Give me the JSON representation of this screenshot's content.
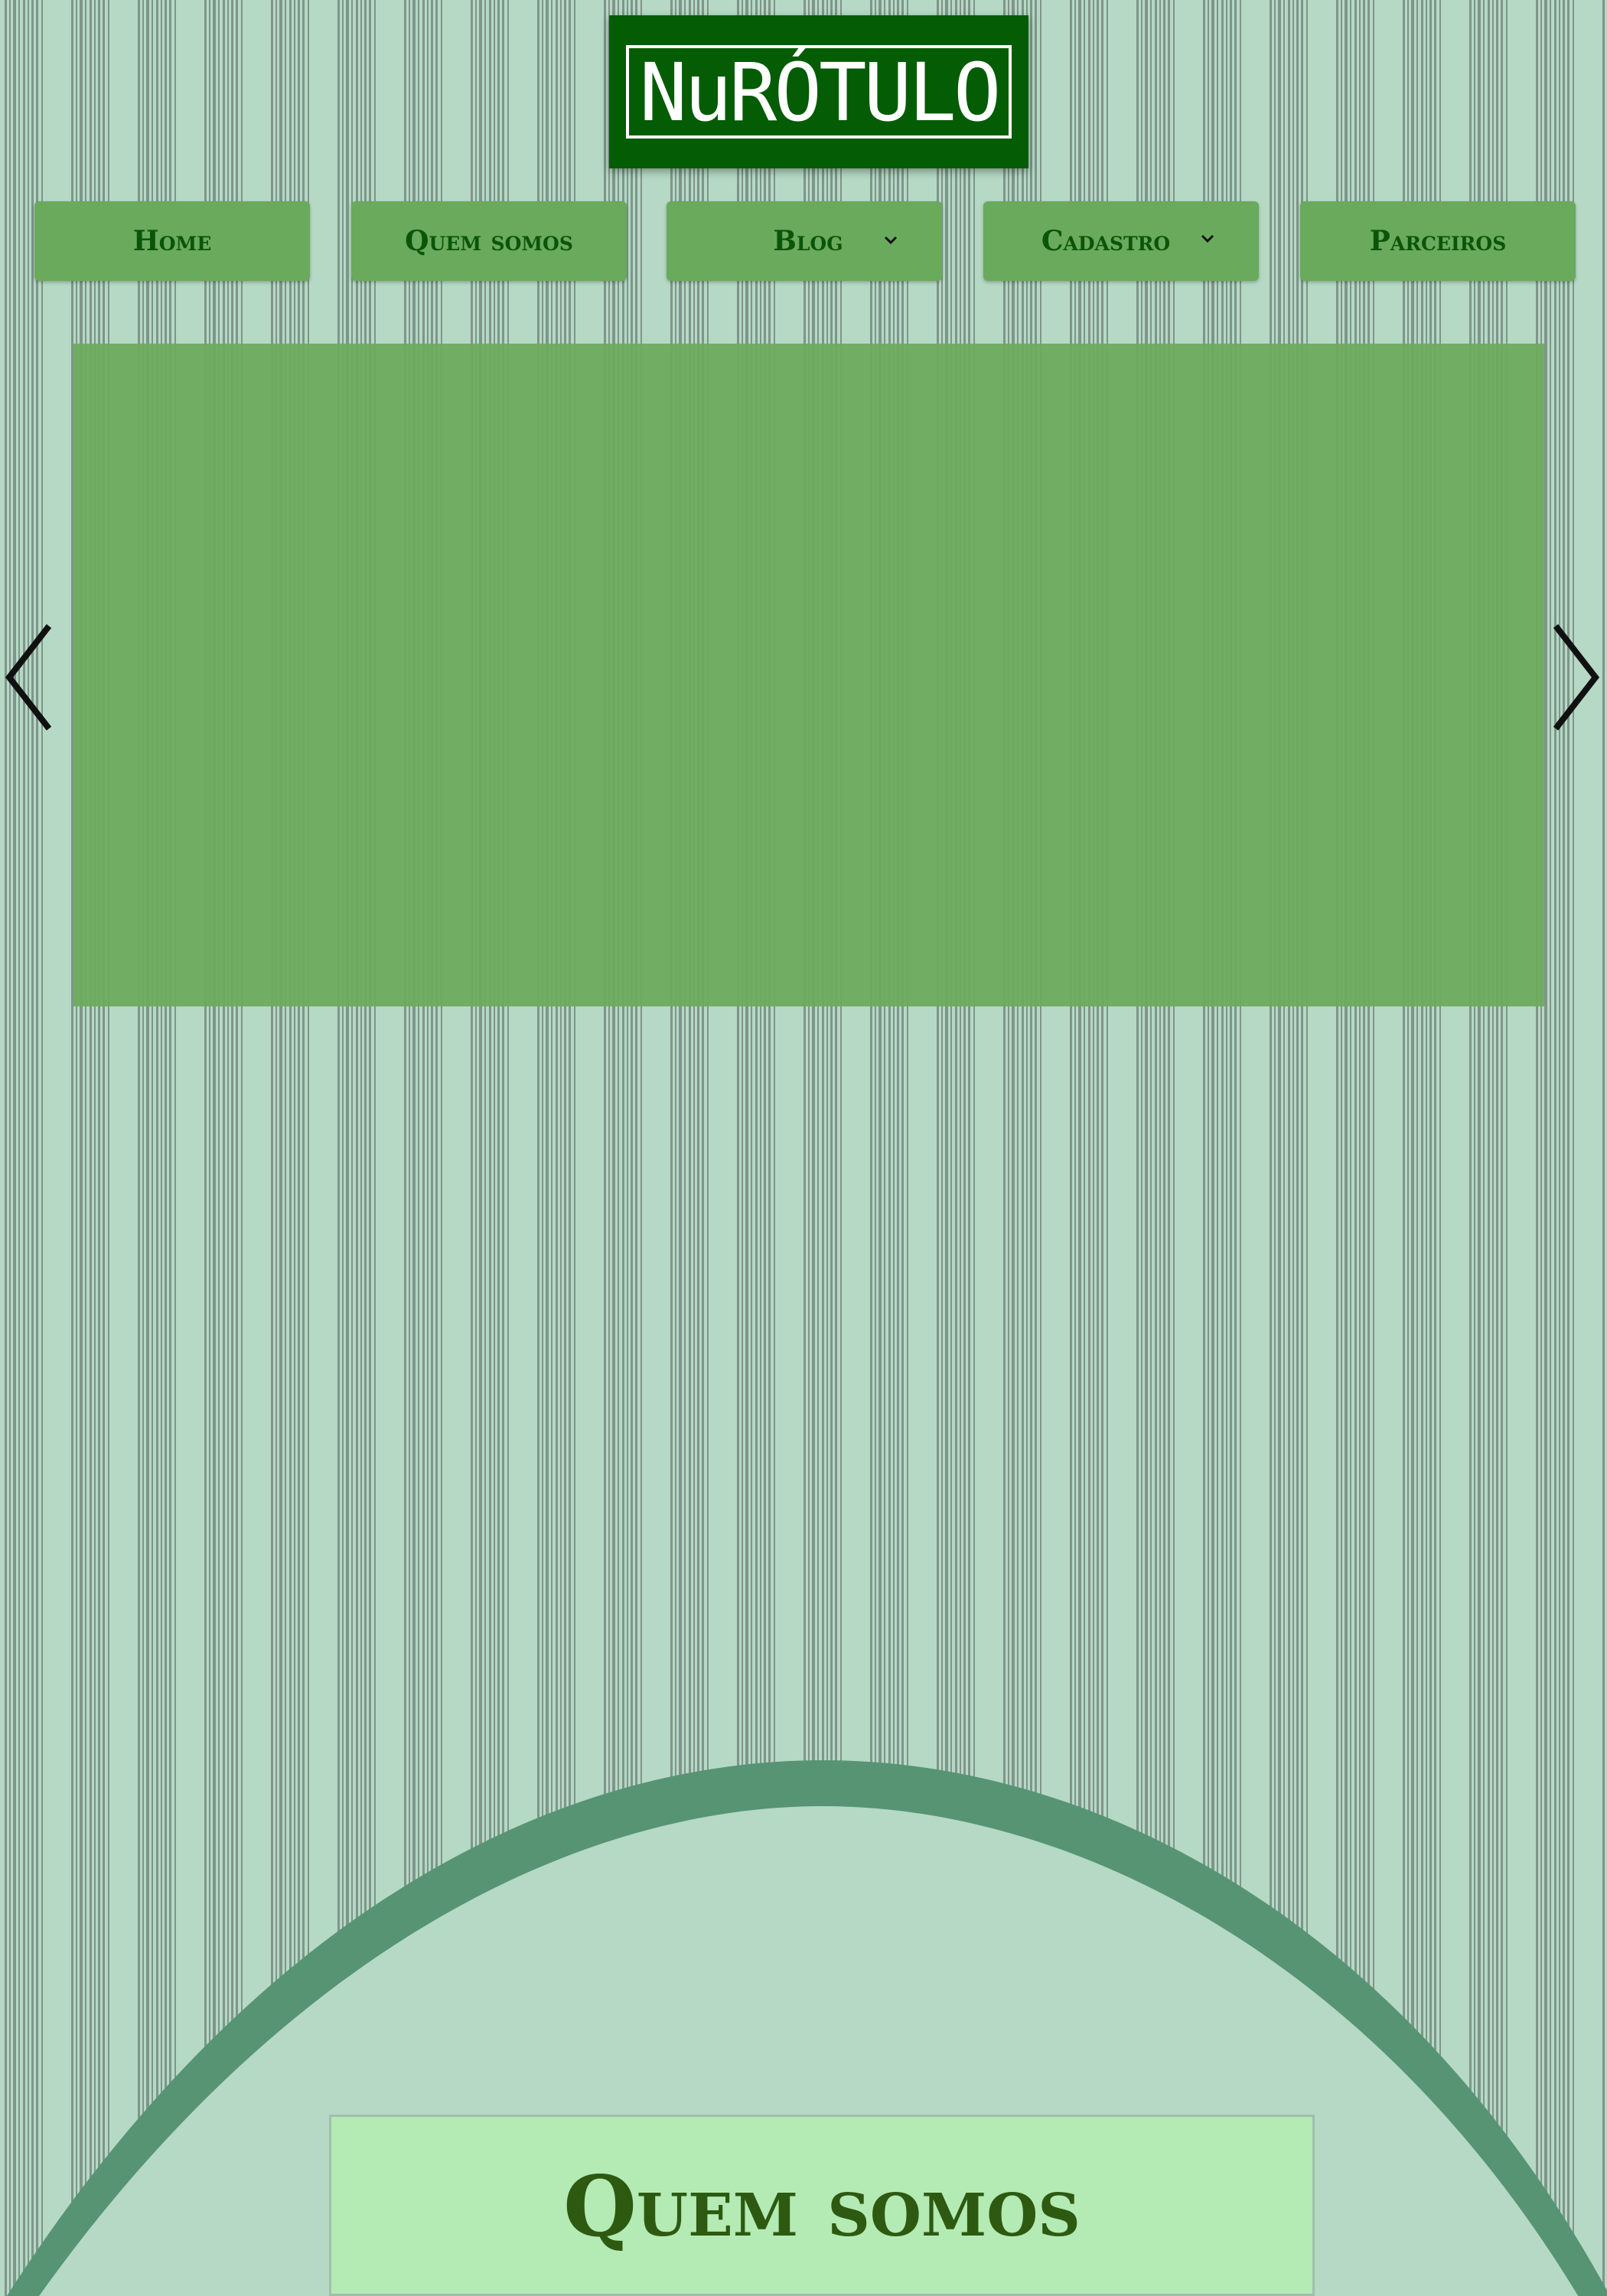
{
  "logo": {
    "text": "NuRÓTULO"
  },
  "nav": {
    "items": [
      {
        "label": "Home",
        "has_dropdown": false
      },
      {
        "label": "Quem somos",
        "has_dropdown": false
      },
      {
        "label": "Blog",
        "has_dropdown": true
      },
      {
        "label": "Cadastro",
        "has_dropdown": true
      },
      {
        "label": "Parceiros",
        "has_dropdown": false
      }
    ]
  },
  "carousel": {
    "prev_icon": "chevron-left-icon",
    "next_icon": "chevron-right-icon"
  },
  "about": {
    "title": "Quem somos"
  },
  "colors": {
    "background": "#b5d9c5",
    "barcode": "#7f958a",
    "logo_bg": "#045c04",
    "nav_bg": "#6aaa5c",
    "nav_text": "#0b550b",
    "carousel_bg": "#6caa5c",
    "arc_stroke": "#569474",
    "about_box_bg": "#b4eab4",
    "about_title": "#2d5a10"
  }
}
